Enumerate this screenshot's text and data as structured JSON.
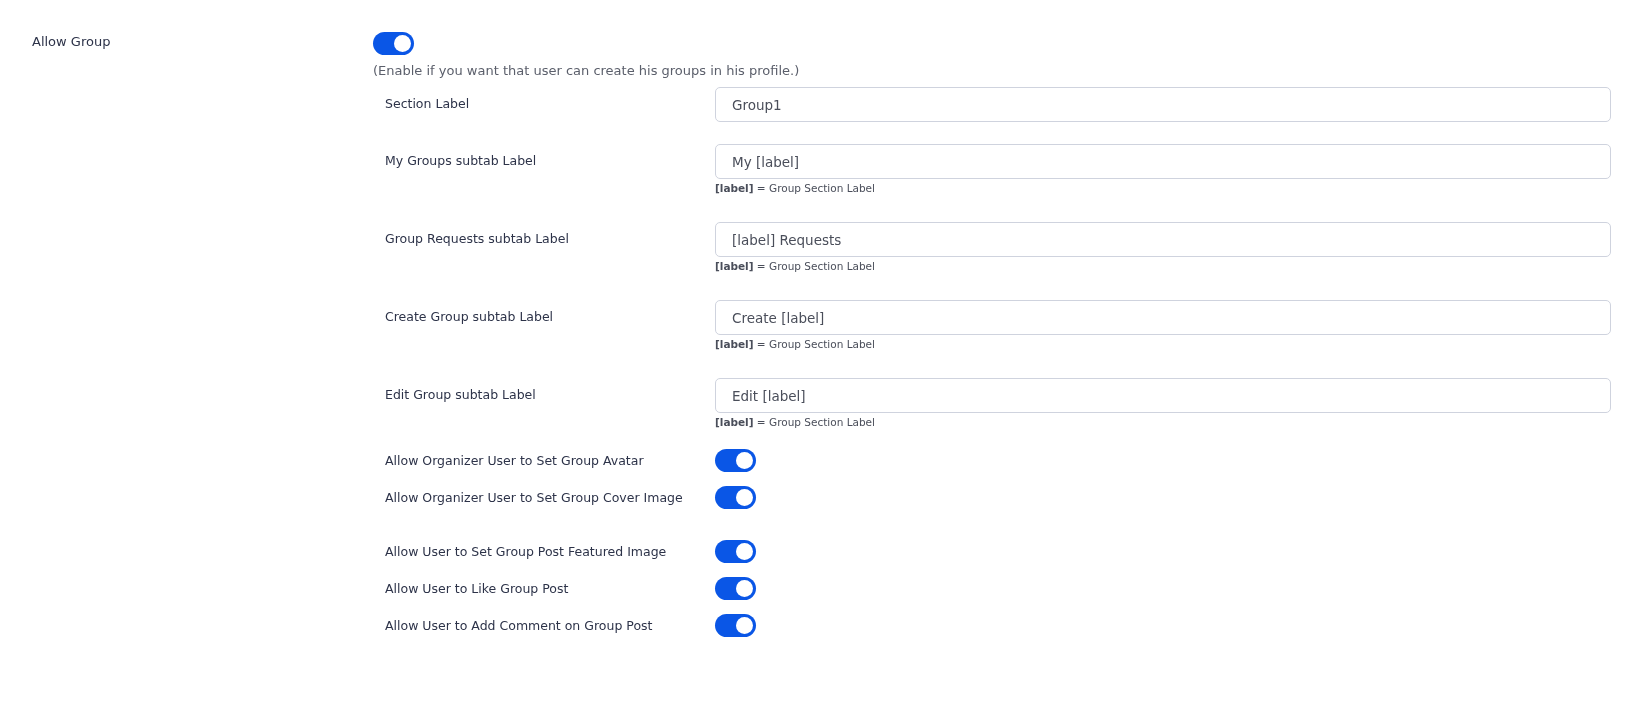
{
  "allow_group": {
    "label": "Allow Group",
    "on": true,
    "description": "(Enable if you want that user can create his groups in his profile.)"
  },
  "settings": [
    {
      "kind": "text",
      "label": "Section Label",
      "value": "Group1"
    },
    {
      "kind": "text",
      "label": "My Groups subtab Label",
      "value": "My [label]",
      "hint": "**[label]** = Group Section Label"
    },
    {
      "kind": "text",
      "label": "Group Requests subtab Label",
      "value": "[label] Requests",
      "hint": "**[label]** = Group Section Label"
    },
    {
      "kind": "text",
      "label": "Create Group subtab Label",
      "value": "Create [label]",
      "hint": "**[label]** = Group Section Label"
    },
    {
      "kind": "text",
      "label": "Edit Group subtab Label",
      "value": "Edit [label]",
      "hint": "**[label]** = Group Section Label"
    },
    {
      "kind": "toggle",
      "label": "Allow Organizer User to Set Group Avatar",
      "on": true
    },
    {
      "kind": "toggle",
      "label": "Allow Organizer User to Set Group Cover Image",
      "on": true
    },
    {
      "kind": "toggle",
      "label": "Allow User to Set Group Post Featured Image",
      "on": true
    },
    {
      "kind": "toggle",
      "label": "Allow User to Like Group Post",
      "on": true
    },
    {
      "kind": "toggle",
      "label": "Allow User to Add Comment on Group Post",
      "on": true
    }
  ]
}
